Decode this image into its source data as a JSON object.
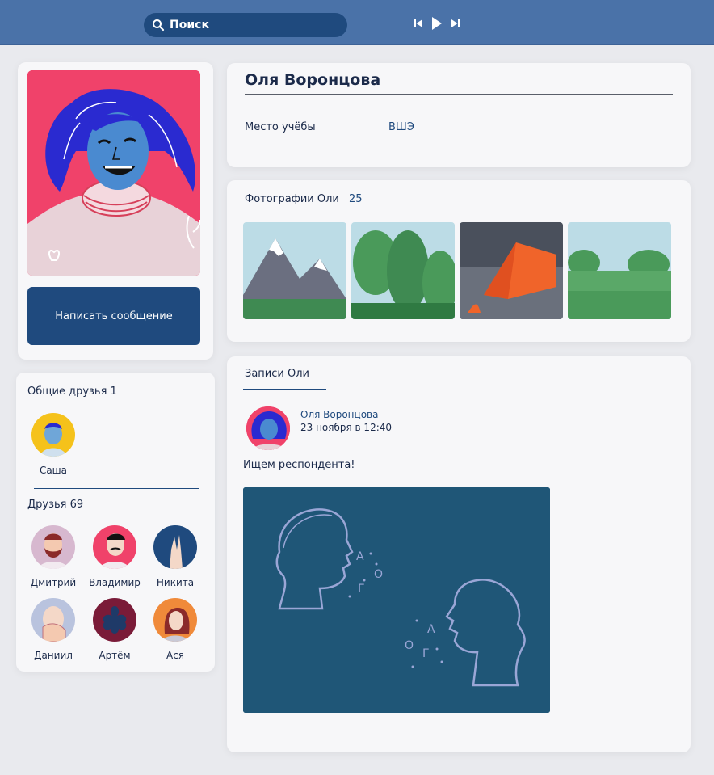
{
  "topbar": {
    "search_label": "Поиск",
    "icons": [
      "search-icon",
      "previous-track-icon",
      "play-icon",
      "next-track-icon"
    ]
  },
  "profile": {
    "name": "Оля Воронцова",
    "message_button": "Написать сообщение",
    "study_label": "Место учёбы",
    "study_value": "ВШЭ"
  },
  "photos": {
    "title": "Фотографии Оли",
    "count": "25",
    "items": [
      "mountains",
      "forest",
      "tent",
      "meadow"
    ]
  },
  "wall": {
    "title": "Записи Оли",
    "post": {
      "author": "Оля Воронцова",
      "date": "23 ноября в 12:40",
      "text": "Ищем респондента!"
    }
  },
  "friends": {
    "common_title": "Общие друзья",
    "common_count": "1",
    "common": [
      {
        "name": "Саша",
        "color": "#f5c21b"
      }
    ],
    "all_title": "Друзья",
    "all_count": "69",
    "list": [
      {
        "name": "Дмитрий",
        "color": "#d7b8cf"
      },
      {
        "name": "Владимир",
        "color": "#f0426a"
      },
      {
        "name": "Никита",
        "color": "#1f4a7e"
      },
      {
        "name": "Даниил",
        "color": "#b9c3de"
      },
      {
        "name": "Артём",
        "color": "#7a1b38"
      },
      {
        "name": "Ася",
        "color": "#f08a3a"
      }
    ]
  },
  "colors": {
    "topbar": "#4a72a8",
    "accent": "#1f4a7e",
    "avatar_bg": "#f0426a"
  }
}
